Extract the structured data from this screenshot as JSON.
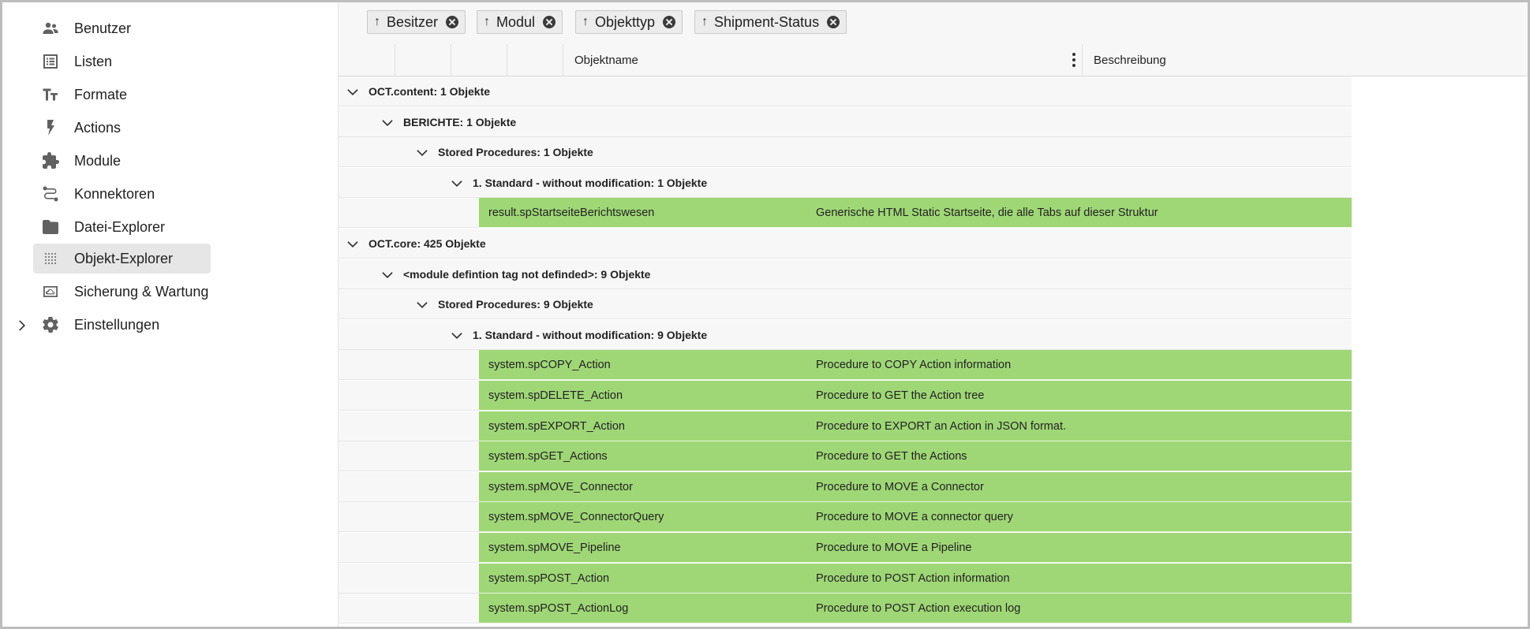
{
  "sidebar": {
    "items": [
      {
        "label": "Benutzer",
        "icon": "people-icon",
        "active": false
      },
      {
        "label": "Listen",
        "icon": "list-icon",
        "active": false
      },
      {
        "label": "Formate",
        "icon": "text-format-icon",
        "active": false
      },
      {
        "label": "Actions",
        "icon": "bolt-icon",
        "active": false
      },
      {
        "label": "Module",
        "icon": "puzzle-icon",
        "active": false
      },
      {
        "label": "Konnektoren",
        "icon": "route-icon",
        "active": false
      },
      {
        "label": "Datei-Explorer",
        "icon": "folder-icon",
        "active": false
      },
      {
        "label": "Objekt-Explorer",
        "icon": "grid-dots-icon",
        "active": true
      },
      {
        "label": "Sicherung & Wartung",
        "icon": "backup-icon",
        "active": false
      },
      {
        "label": "Einstellungen",
        "icon": "gear-icon",
        "active": false,
        "expandable": true
      }
    ]
  },
  "chips": [
    {
      "label": "Besitzer",
      "arrow": "↑"
    },
    {
      "label": "Modul",
      "arrow": "↑"
    },
    {
      "label": "Objekttyp",
      "arrow": "↑"
    },
    {
      "label": "Shipment-Status",
      "arrow": "↑"
    }
  ],
  "columns": {
    "name": "Objektname",
    "description": "Beschreibung"
  },
  "rows": [
    {
      "kind": "group",
      "level": 0,
      "label": "OCT.content: 1 Objekte"
    },
    {
      "kind": "group",
      "level": 1,
      "label": "BERICHTE: 1 Objekte"
    },
    {
      "kind": "group",
      "level": 2,
      "label": "Stored Procedures: 1 Objekte"
    },
    {
      "kind": "group",
      "level": 3,
      "label": "1. Standard - without modification: 1 Objekte"
    },
    {
      "kind": "data",
      "name": "result.spStartseiteBerichtswesen",
      "desc": "Generische HTML Static Startseite, die alle Tabs auf dieser Struktur"
    },
    {
      "kind": "group",
      "level": 0,
      "label": "OCT.core: 425 Objekte"
    },
    {
      "kind": "group",
      "level": 1,
      "label": "<module defintion tag not definded>: 9 Objekte"
    },
    {
      "kind": "group",
      "level": 2,
      "label": "Stored Procedures: 9 Objekte"
    },
    {
      "kind": "group",
      "level": 3,
      "label": "1. Standard - without modification: 9 Objekte"
    },
    {
      "kind": "data",
      "name": "system.spCOPY_Action",
      "desc": "Procedure to COPY Action information"
    },
    {
      "kind": "data",
      "name": "system.spDELETE_Action",
      "desc": "Procedure to GET the Action tree"
    },
    {
      "kind": "data",
      "name": "system.spEXPORT_Action",
      "desc": "Procedure to EXPORT an Action in JSON format."
    },
    {
      "kind": "data",
      "name": "system.spGET_Actions",
      "desc": "Procedure to GET the Actions"
    },
    {
      "kind": "data",
      "name": "system.spMOVE_Connector",
      "desc": "Procedure to MOVE a Connector"
    },
    {
      "kind": "data",
      "name": "system.spMOVE_ConnectorQuery",
      "desc": "Procedure to MOVE a connector query"
    },
    {
      "kind": "data",
      "name": "system.spMOVE_Pipeline",
      "desc": "Procedure to MOVE a Pipeline"
    },
    {
      "kind": "data",
      "name": "system.spPOST_Action",
      "desc": "Procedure to POST Action information"
    },
    {
      "kind": "data",
      "name": "system.spPOST_ActionLog",
      "desc": "Procedure to POST Action execution log"
    }
  ],
  "colors": {
    "highlight": "#9fd776",
    "active_nav": "#e6e6e6"
  }
}
